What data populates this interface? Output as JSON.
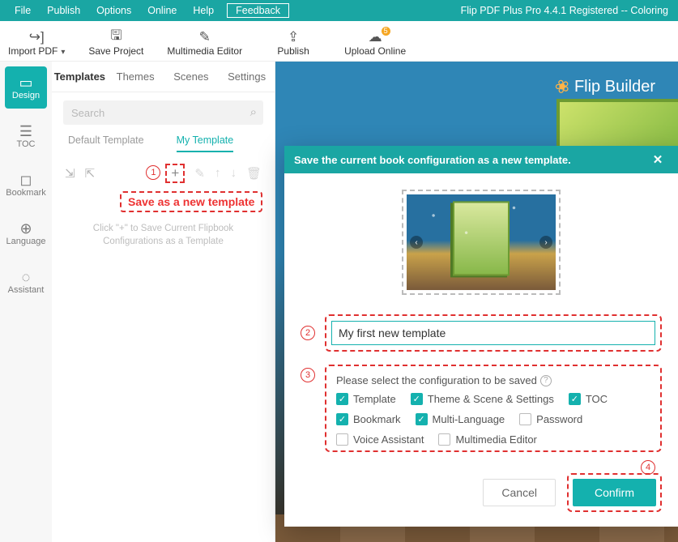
{
  "menubar": {
    "items": [
      "File",
      "Publish",
      "Options",
      "Online",
      "Help"
    ],
    "feedback": "Feedback",
    "title": "Flip PDF Plus Pro 4.4.1 Registered -- Coloring"
  },
  "toolbar": {
    "import": "Import PDF",
    "save": "Save Project",
    "multimedia": "Multimedia Editor",
    "publish": "Publish",
    "upload": "Upload Online",
    "upload_badge": "5"
  },
  "rail": {
    "design": "Design",
    "toc": "TOC",
    "bookmark": "Bookmark",
    "language": "Language",
    "assistant": "Assistant"
  },
  "panel": {
    "tabs": [
      "Templates",
      "Themes",
      "Scenes",
      "Settings"
    ],
    "search_placeholder": "Search",
    "subtabs": {
      "default": "Default Template",
      "mine": "My Template"
    },
    "callout": "Save as a new template",
    "hint": "Click \"+\" to Save Current Flipbook Configurations as a Template",
    "marker1": "1"
  },
  "brand": "Flip Builder",
  "modal": {
    "title": "Save the current book configuration as a new template.",
    "name_value": "My first new template",
    "config_label": "Please select the configuration to be saved",
    "options": {
      "template": {
        "label": "Template",
        "checked": true
      },
      "theme": {
        "label": "Theme & Scene & Settings",
        "checked": true
      },
      "toc": {
        "label": "TOC",
        "checked": true
      },
      "bookmark": {
        "label": "Bookmark",
        "checked": true
      },
      "multilang": {
        "label": "Multi-Language",
        "checked": true
      },
      "password": {
        "label": "Password",
        "checked": false
      },
      "voice": {
        "label": "Voice Assistant",
        "checked": false
      },
      "multimedia": {
        "label": "Multimedia Editor",
        "checked": false
      }
    },
    "cancel": "Cancel",
    "confirm": "Confirm",
    "markers": {
      "m2": "2",
      "m3": "3",
      "m4": "4"
    }
  }
}
